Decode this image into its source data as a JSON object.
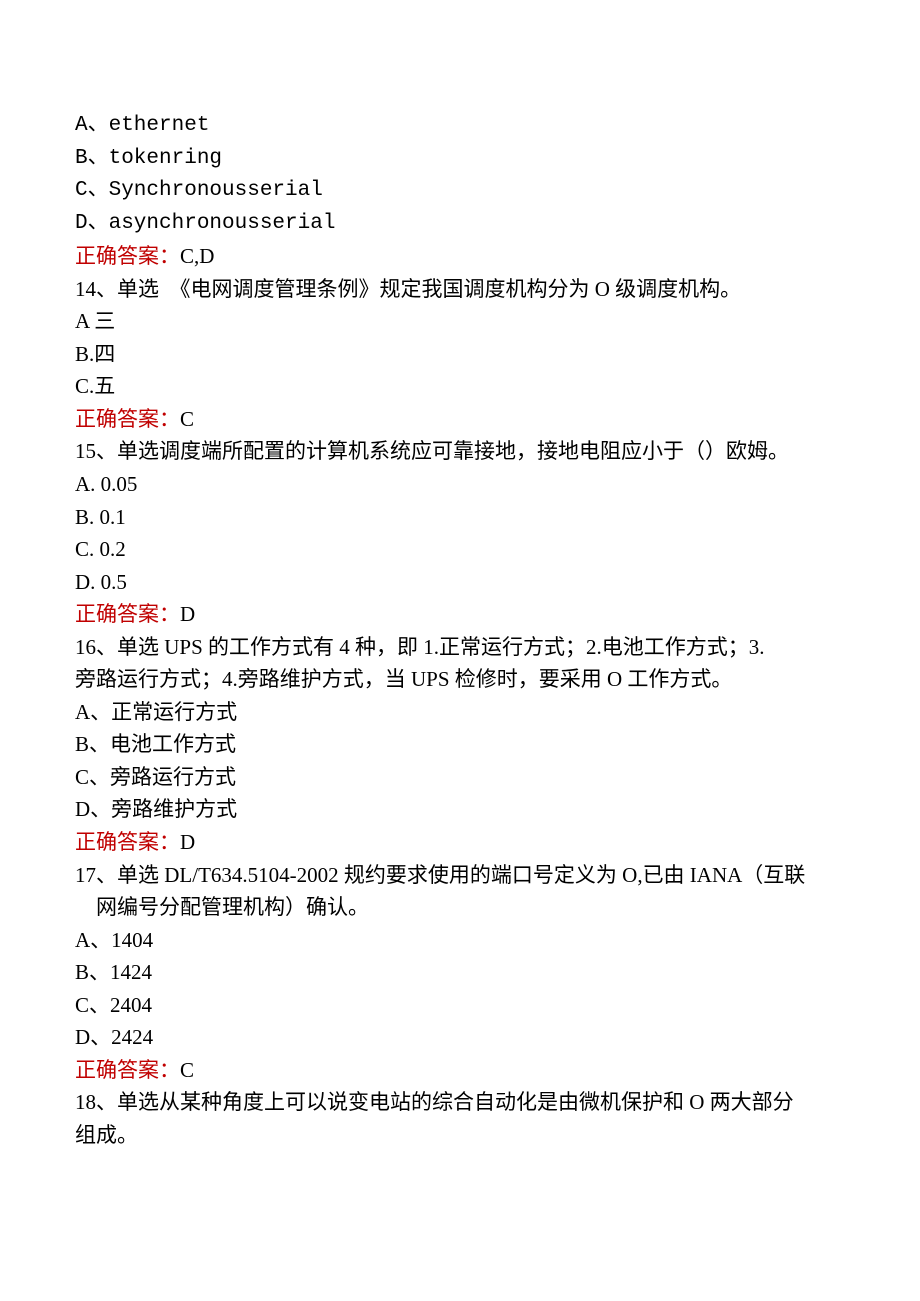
{
  "q13": {
    "optA": "A、ethernet",
    "optB": "B、tokenring",
    "optC": "C、Synchronousserial",
    "optD": "D、asynchronousserial",
    "answerLabel": "正确答案：",
    "answerValue": "C,D"
  },
  "q14": {
    "stem": "14、单选　《电网调度管理条例》规定我国调度机构分为 O 级调度机构。",
    "optA": "A 三",
    "optB": "B.四",
    "optC": "C.五",
    "answerLabel": "正确答案：",
    "answerValue": "C"
  },
  "q15": {
    "stem": "15、单选调度端所配置的计算机系统应可靠接地，接地电阻应小于（）欧姆。",
    "optA": "A. 0.05",
    "optB": "B. 0.1",
    "optC": "C. 0.2",
    "optD": "D. 0.5",
    "answerLabel": "正确答案：",
    "answerValue": "D"
  },
  "q16": {
    "stem1": "16、单选 UPS 的工作方式有 4 种，即 1.正常运行方式；2.电池工作方式；3.",
    "stem2": "旁路运行方式；4.旁路维护方式，当 UPS 检修时，要采用 O 工作方式。",
    "optA": "A、正常运行方式",
    "optB": "B、电池工作方式",
    "optC": "C、旁路运行方式",
    "optD": "D、旁路维护方式",
    "answerLabel": "正确答案：",
    "answerValue": "D"
  },
  "q17": {
    "stem1": "17、单选 DL/T634.5104-2002 规约要求使用的端口号定义为 O,已由 IANA（互联",
    "stem2": "　网编号分配管理机构）确认。",
    "optA": "A、1404",
    "optB": "B、1424",
    "optC": "C、2404",
    "optD": "D、2424",
    "answerLabel": "正确答案：",
    "answerValue": "C"
  },
  "q18": {
    "stem1": "18、单选从某种角度上可以说变电站的综合自动化是由微机保护和 O 两大部分",
    "stem2": "组成。"
  }
}
